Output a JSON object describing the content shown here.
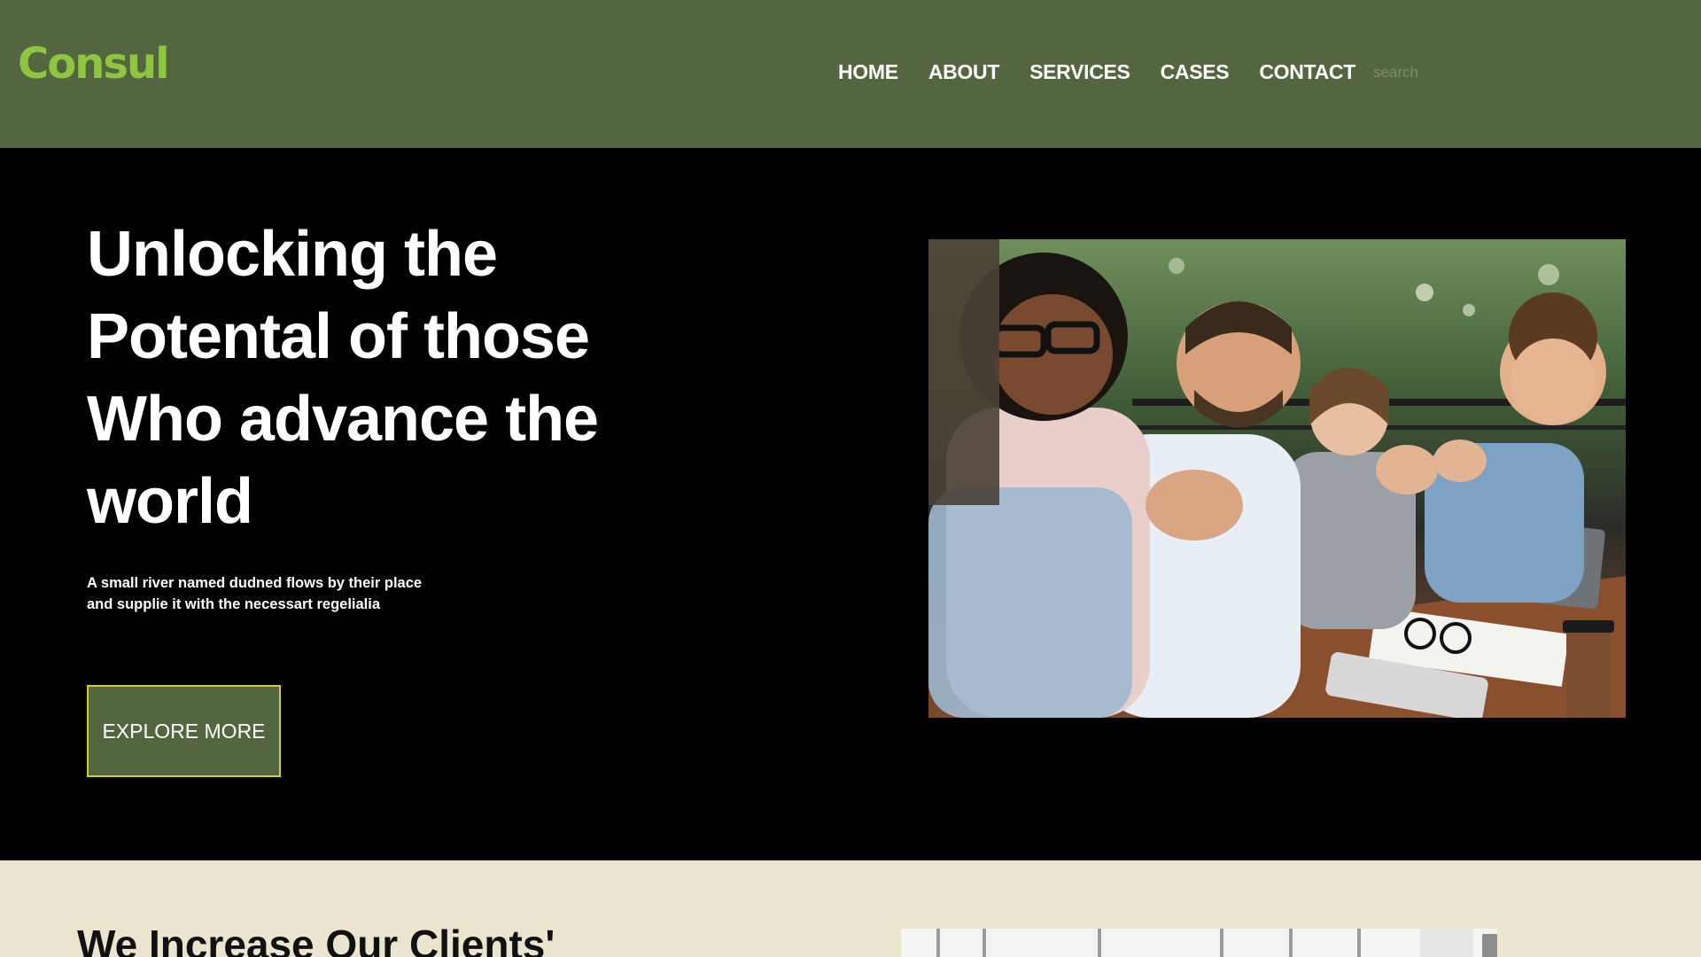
{
  "header": {
    "logo": "Consul",
    "nav": [
      "HOME",
      "ABOUT",
      "SERVICES",
      "CASES",
      "CONTACT"
    ],
    "search_placeholder": "search"
  },
  "hero": {
    "title_lines": [
      "Unlocking the",
      "Potental of those",
      "Who advance the",
      "world"
    ],
    "subtitle_lines": [
      "A small river named dudned flows by their place",
      "and supplie it with the necessart regelialia"
    ],
    "button_label": "EXPLORE MORE"
  },
  "lower": {
    "heading": "We Increase Our Clients'"
  },
  "colors": {
    "header_bg": "#536640",
    "logo": "#8ec63f",
    "hero_bg": "#000000",
    "button_border": "#d1cf2c",
    "lower_bg": "#ebe4cf"
  }
}
